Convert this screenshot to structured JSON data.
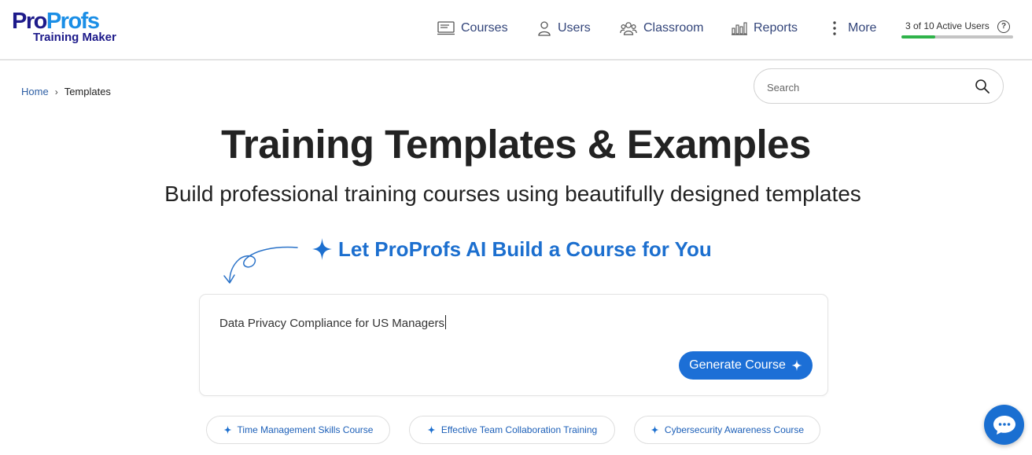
{
  "brand": {
    "logo_part1": "Pro",
    "logo_part2": "Profs",
    "logo_subtitle": "Training Maker"
  },
  "nav": {
    "items": [
      {
        "label": "Courses",
        "icon": "courses-icon"
      },
      {
        "label": "Users",
        "icon": "user-icon"
      },
      {
        "label": "Classroom",
        "icon": "classroom-icon"
      },
      {
        "label": "Reports",
        "icon": "reports-icon"
      },
      {
        "label": "More",
        "icon": "more-vertical-icon"
      }
    ]
  },
  "active_users": {
    "text": "3 of 10 Active Users",
    "used": 3,
    "total": 10,
    "help_label": "?"
  },
  "breadcrumb": {
    "home": "Home",
    "separator": "›",
    "current": "Templates"
  },
  "search": {
    "placeholder": "Search"
  },
  "hero": {
    "title": "Training Templates & Examples",
    "subtitle": "Build professional training courses using beautifully designed templates"
  },
  "ai": {
    "heading": "Let ProProfs AI Build a Course for You",
    "prompt_value": "Data Privacy Compliance for US Managers",
    "generate_label": "Generate Course"
  },
  "suggestions": [
    "Time Management Skills Course",
    "Effective Team Collaboration Training",
    "Cybersecurity Awareness Course"
  ],
  "colors": {
    "brand_navy": "#1d1a8a",
    "brand_blue": "#1a8ee6",
    "accent": "#1c6fd6",
    "progress": "#2fb34a"
  }
}
